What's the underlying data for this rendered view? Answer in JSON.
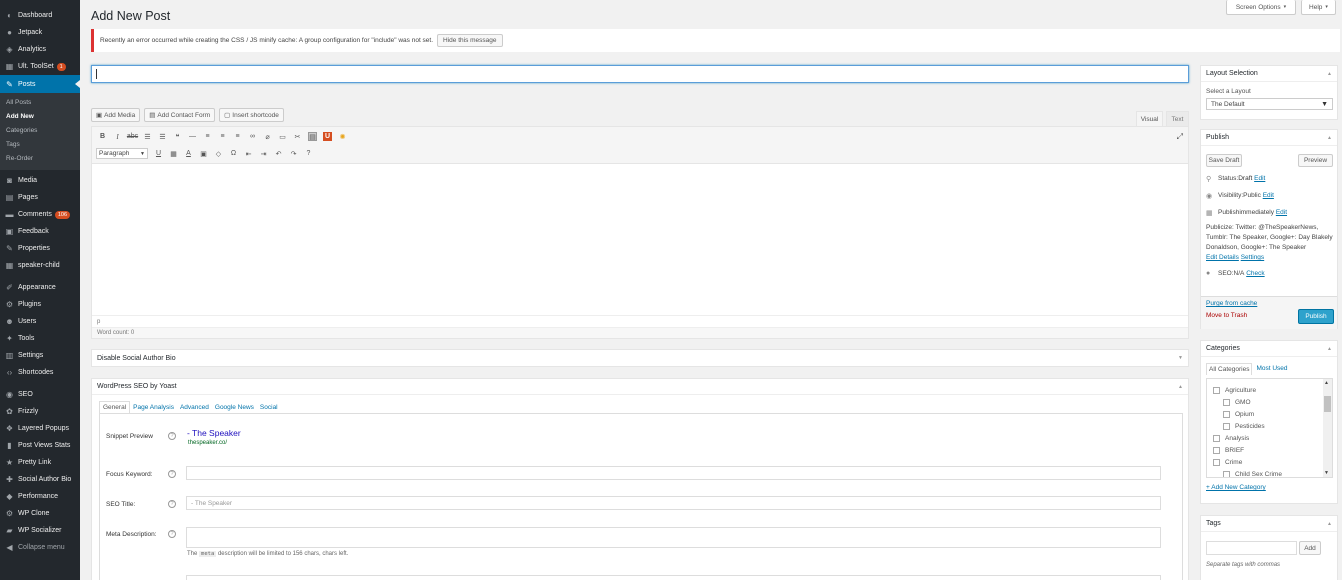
{
  "sidebar": {
    "items_top": [
      {
        "icon": "dashboard-icon",
        "glyph": "◐",
        "label": "Dashboard"
      },
      {
        "icon": "jetpack-icon",
        "glyph": "●",
        "label": "Jetpack"
      },
      {
        "icon": "analytics-icon",
        "glyph": "◈",
        "label": "Analytics"
      },
      {
        "icon": "toolset-icon",
        "glyph": "▦",
        "label": "Ult. ToolSet",
        "badge": "1"
      }
    ],
    "posts": {
      "label": "Posts",
      "glyph": "✎"
    },
    "submenu": [
      "All Posts",
      "Add New",
      "Categories",
      "Tags",
      "Re-Order"
    ],
    "items_mid": [
      {
        "icon": "media-icon",
        "glyph": "◙",
        "label": "Media"
      },
      {
        "icon": "pages-icon",
        "glyph": "▤",
        "label": "Pages"
      },
      {
        "icon": "comments-icon",
        "glyph": "▬",
        "label": "Comments",
        "badge": "106"
      },
      {
        "icon": "feedback-icon",
        "glyph": "▣",
        "label": "Feedback"
      },
      {
        "icon": "properties-icon",
        "glyph": "✎",
        "label": "Properties"
      },
      {
        "icon": "speaker-child-icon",
        "glyph": "▦",
        "label": "speaker-child"
      }
    ],
    "items_bottom": [
      {
        "icon": "appearance-icon",
        "glyph": "✐",
        "label": "Appearance"
      },
      {
        "icon": "plugins-icon",
        "glyph": "⚙",
        "label": "Plugins"
      },
      {
        "icon": "users-icon",
        "glyph": "☻",
        "label": "Users"
      },
      {
        "icon": "tools-icon",
        "glyph": "✦",
        "label": "Tools"
      },
      {
        "icon": "settings-icon",
        "glyph": "▥",
        "label": "Settings"
      },
      {
        "icon": "shortcodes-icon",
        "glyph": "‹›",
        "label": "Shortcodes"
      }
    ],
    "items_plugins": [
      {
        "icon": "seo-icon",
        "glyph": "◉",
        "label": "SEO"
      },
      {
        "icon": "frizzly-icon",
        "glyph": "✿",
        "label": "Frizzly"
      },
      {
        "icon": "layered-popups-icon",
        "glyph": "❖",
        "label": "Layered Popups"
      },
      {
        "icon": "post-views-icon",
        "glyph": "▮",
        "label": "Post Views Stats"
      },
      {
        "icon": "pretty-link-icon",
        "glyph": "★",
        "label": "Pretty Link"
      },
      {
        "icon": "social-author-icon",
        "glyph": "✚",
        "label": "Social Author Bio"
      },
      {
        "icon": "performance-icon",
        "glyph": "◆",
        "label": "Performance"
      },
      {
        "icon": "wp-clone-icon",
        "glyph": "⚙",
        "label": "WP Clone"
      },
      {
        "icon": "wp-socializer-icon",
        "glyph": "▰",
        "label": "WP Socializer"
      }
    ],
    "collapse": "Collapse menu"
  },
  "header": {
    "title": "Add New Post",
    "screen_options": "Screen Options",
    "help": "Help"
  },
  "notice": {
    "text": "Recently an error occurred while creating the CSS / JS minify cache: A group configuration for \"include\" was not set.",
    "button": "Hide this message"
  },
  "editor": {
    "media_buttons": [
      "Add Media",
      "Add Contact Form",
      "Insert shortcode"
    ],
    "tabs": {
      "visual": "Visual",
      "text": "Text"
    },
    "format_select": "Paragraph",
    "path": "p",
    "word_count": "Word count: 0"
  },
  "boxes": {
    "social_bio": "Disable Social Author Bio",
    "yoast": "WordPress SEO by Yoast"
  },
  "yoast": {
    "tabs": [
      "General",
      "Page Analysis",
      "Advanced",
      "Google News",
      "Social"
    ],
    "snippet_label": "Snippet Preview",
    "snippet_title": " - The Speaker",
    "snippet_url": "thespeaker.co/",
    "focus_label": "Focus Keyword:",
    "seo_title_label": "SEO Title:",
    "seo_title_placeholder": " - The Speaker",
    "meta_label": "Meta Description:",
    "meta_note_pre": "The",
    "meta_note_code": "meta",
    "meta_note_post": "description will be limited to 156 chars, chars left."
  },
  "layout": {
    "title": "Layout Selection",
    "select_label": "Select a Layout",
    "selected": "The Default"
  },
  "publish": {
    "title": "Publish",
    "save_draft": "Save Draft",
    "preview": "Preview",
    "status_pre": "Status: ",
    "status_val": "Draft",
    "visibility_pre": "Visibility: ",
    "visibility_val": "Public",
    "publish_pre": "Publish ",
    "publish_val": "immediately",
    "edit": "Edit",
    "publicize": "Publicize: Twitter: @TheSpeakerNews, Tumblr: The Speaker, Google+: Day Blakely Donaldson, Google+: The Speaker",
    "edit_details": "Edit Details",
    "settings": "Settings",
    "seo_pre": "SEO: ",
    "seo_val": "N/A",
    "check": "Check",
    "purge": "Purge from cache",
    "trash": "Move to Trash",
    "publish_btn": "Publish"
  },
  "categories": {
    "title": "Categories",
    "tab_all": "All Categories",
    "tab_most": "Most Used",
    "items": [
      {
        "label": "Agriculture",
        "indent": 0
      },
      {
        "label": "GMO",
        "indent": 1
      },
      {
        "label": "Opium",
        "indent": 1
      },
      {
        "label": "Pesticides",
        "indent": 1
      },
      {
        "label": "Analysis",
        "indent": 0
      },
      {
        "label": "BRIEF",
        "indent": 0
      },
      {
        "label": "Crime",
        "indent": 0
      },
      {
        "label": "Child Sex Crime",
        "indent": 1
      }
    ],
    "add_new": "+ Add New Category"
  },
  "tags": {
    "title": "Tags",
    "add": "Add",
    "hint": "Separate tags with commas"
  },
  "colors": {
    "primary": "#0073aa",
    "sidebar": "#23282d",
    "publish": "#2ea2cc",
    "error": "#dc3232"
  }
}
